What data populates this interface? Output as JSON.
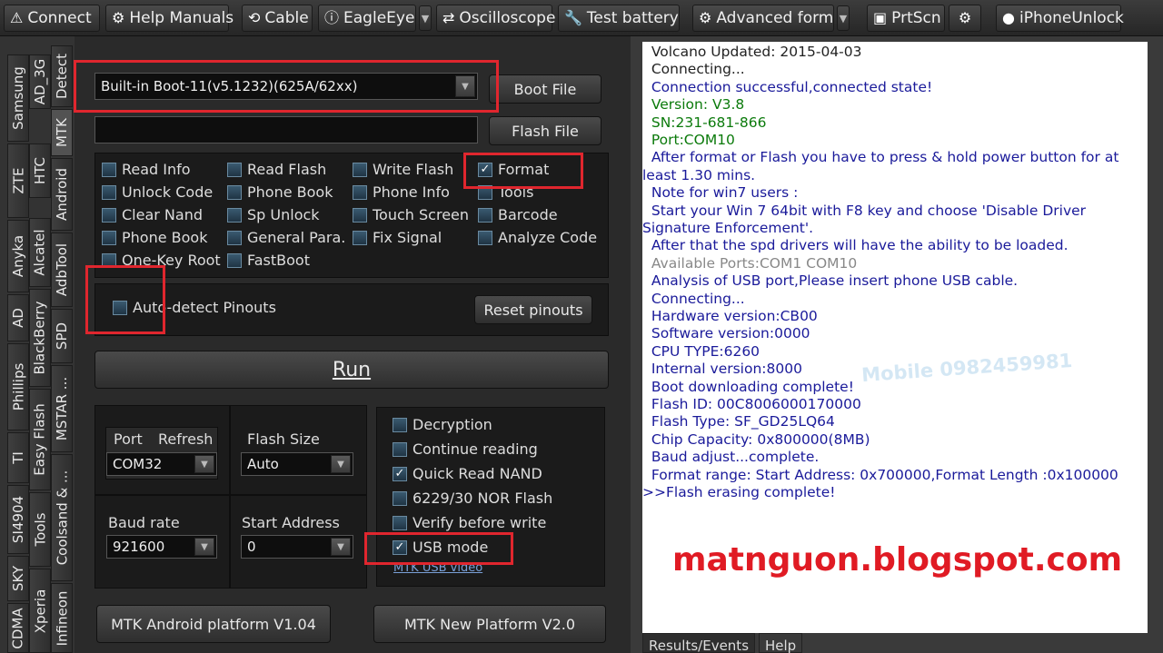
{
  "toolbar": {
    "connect": "Connect",
    "help_manuals": "Help Manuals",
    "cable": "Cable",
    "eagleeye": "EagleEye",
    "oscilloscope": "Oscilloscope",
    "test_battery": "Test battery",
    "advanced_form": "Advanced form",
    "prtscn": "PrtScn",
    "iphone_unlock": "iPhoneUnlock"
  },
  "left_tabs": {
    "col1": [
      "Samsung",
      "ZTE",
      "Anyka",
      "AD",
      "Phillips",
      "TI",
      "SI4904",
      "SKY",
      "CDMA"
    ],
    "col2": [
      "AD_3G",
      "HTC",
      "Alcatel",
      "BlackBerry",
      "Easy Flash",
      "Tools",
      "Xperia"
    ],
    "col3": [
      "Detect",
      "MTK",
      "Android",
      "AdbTool",
      "SPD",
      "MSTAR ...",
      "Coolsand & ...",
      "Infineon"
    ]
  },
  "boot": {
    "selected": "Built-in Boot-11(v5.1232)(625A/62xx)",
    "boot_file": "Boot File",
    "flash_file": "Flash File",
    "flash_path": ""
  },
  "functions": [
    {
      "label": "Read Info",
      "checked": false
    },
    {
      "label": "Read Flash",
      "checked": false
    },
    {
      "label": "Write Flash",
      "checked": false
    },
    {
      "label": "Format",
      "checked": true
    },
    {
      "label": "Unlock Code",
      "checked": false
    },
    {
      "label": "Phone Book",
      "checked": false
    },
    {
      "label": "Phone Info",
      "checked": false
    },
    {
      "label": "Tools",
      "checked": false
    },
    {
      "label": "Clear Nand",
      "checked": false
    },
    {
      "label": "Sp Unlock",
      "checked": false
    },
    {
      "label": "Touch Screen",
      "checked": false
    },
    {
      "label": "Barcode",
      "checked": false
    },
    {
      "label": "Phone Book",
      "checked": false
    },
    {
      "label": "General Para.",
      "checked": false
    },
    {
      "label": "Fix Signal",
      "checked": false
    },
    {
      "label": "Analyze Code",
      "checked": false
    },
    {
      "label": "One-Key Root",
      "checked": false
    },
    {
      "label": "FastBoot",
      "checked": false
    }
  ],
  "pinouts": {
    "auto_detect": "Auto-detect Pinouts",
    "reset": "Reset pinouts"
  },
  "run": "Run",
  "port": {
    "port_label": "Port",
    "refresh_label": "Refresh",
    "value": "COM32"
  },
  "flash_size": {
    "label": "Flash Size",
    "value": "Auto"
  },
  "baud": {
    "label": "Baud rate",
    "value": "921600"
  },
  "start_address": {
    "label": "Start Address",
    "value": "0"
  },
  "options": [
    {
      "label": "Decryption",
      "checked": false
    },
    {
      "label": "Continue reading",
      "checked": false
    },
    {
      "label": "Quick Read NAND",
      "checked": true
    },
    {
      "label": "6229/30 NOR Flash",
      "checked": false
    },
    {
      "label": "Verify before write",
      "checked": false
    },
    {
      "label": "USB mode",
      "checked": true
    }
  ],
  "usb_video_link": "MTK USB video",
  "platform_buttons": {
    "android": "MTK Android platform V1.04",
    "new": "MTK New Platform V2.0"
  },
  "log_lines": [
    {
      "text": "  Volcano Updated: 2015-04-03",
      "color": "black"
    },
    {
      "text": "  Connecting...",
      "color": "black"
    },
    {
      "text": "  Connection successful,connected state!",
      "color": "navy"
    },
    {
      "text": "  Version: V3.8",
      "color": "green"
    },
    {
      "text": "  SN:231-681-866",
      "color": "green"
    },
    {
      "text": "  Port:COM10",
      "color": "green"
    },
    {
      "text": "  After format or Flash you have to press & hold power button for at",
      "color": "navy"
    },
    {
      "text": "least 1.30 mins.",
      "color": "navy"
    },
    {
      "text": "  Note for win7 users :",
      "color": "navy"
    },
    {
      "text": "  Start your Win 7 64bit with F8 key and choose 'Disable Driver",
      "color": "navy"
    },
    {
      "text": "Signature Enforcement'.",
      "color": "navy"
    },
    {
      "text": "  After that the spd drivers will have the ability to be loaded.",
      "color": "navy"
    },
    {
      "text": "  Available Ports:COM1 COM10",
      "color": "gray"
    },
    {
      "text": "  Analysis of USB port,Please insert phone USB cable.",
      "color": "navy"
    },
    {
      "text": "  Connecting...",
      "color": "navy"
    },
    {
      "text": "  Hardware version:CB00",
      "color": "navy"
    },
    {
      "text": "  Software version:0000",
      "color": "navy"
    },
    {
      "text": "  CPU TYPE:6260",
      "color": "navy"
    },
    {
      "text": "  Internal version:8000",
      "color": "navy"
    },
    {
      "text": "  Boot downloading complete!",
      "color": "navy"
    },
    {
      "text": "  Flash ID: 00C8006000170000",
      "color": "navy"
    },
    {
      "text": "  Flash Type: SF_GD25LQ64",
      "color": "navy"
    },
    {
      "text": "  Chip Capacity: 0x800000(8MB)",
      "color": "navy"
    },
    {
      "text": "  Baud adjust...complete.",
      "color": "navy"
    },
    {
      "text": "  Format range: Start Address: 0x700000,Format Length :0x100000",
      "color": "navy"
    },
    {
      "text": ">>Flash erasing complete!",
      "color": "navy"
    }
  ],
  "watermark": "Mobile 0982459981",
  "bottom_tabs": [
    "Results/Events",
    "Help"
  ],
  "brand": "matnguon.blogspot.com",
  "colors": {
    "highlight": "#e0262e",
    "brand": "#e01b24",
    "log_bg": "#ffffff"
  }
}
